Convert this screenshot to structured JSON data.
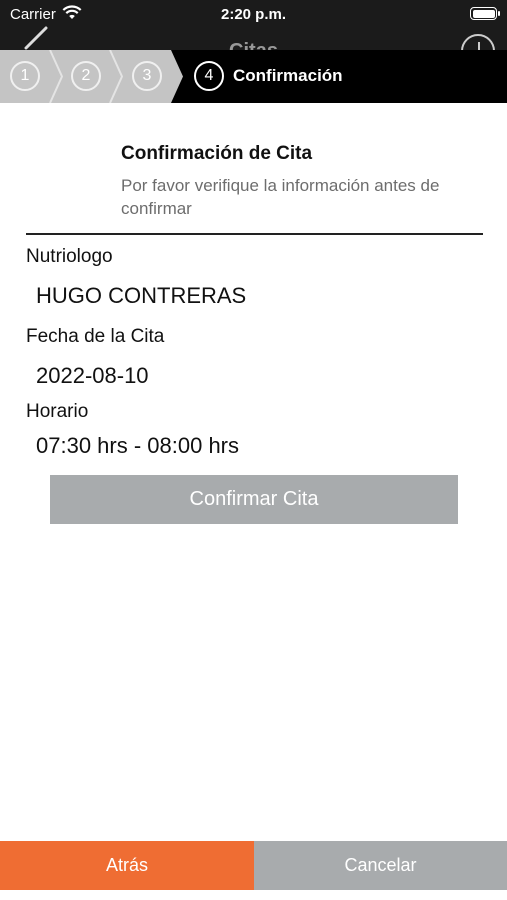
{
  "status_bar": {
    "carrier": "Carrier",
    "time": "2:20 p.m."
  },
  "nav": {
    "title": "Citas"
  },
  "stepper": {
    "steps": [
      "1",
      "2",
      "3",
      "4"
    ],
    "active_label": "Confirmación"
  },
  "confirmation": {
    "title": "Confirmación de Cita",
    "subtitle": "Por favor verifique la información antes de confirmar"
  },
  "fields": {
    "nutriologo_label": "Nutriologo",
    "nutriologo_value": "HUGO CONTRERAS",
    "fecha_label": "Fecha de la Cita",
    "fecha_value": "2022-08-10",
    "horario_label": "Horario",
    "horario_value": "07:30 hrs - 08:00 hrs"
  },
  "buttons": {
    "confirm": "Confirmar Cita",
    "back": "Atrás",
    "cancel": "Cancelar"
  },
  "colors": {
    "accent": "#ef6d33",
    "disabled": "#a8abad",
    "header": "#000000"
  },
  "icons": {
    "wifi": "wifi-icon",
    "battery": "battery-icon",
    "back": "chevron-left-icon",
    "add": "plus-circle-icon"
  }
}
